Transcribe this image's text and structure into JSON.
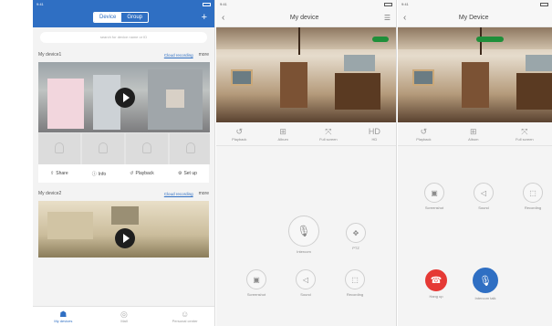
{
  "phone1": {
    "status_time": "9:41",
    "tabs_segment": [
      "Device",
      "Group"
    ],
    "add_label": "+",
    "search_placeholder": "search for device name or ID",
    "device1": {
      "title": "My device1",
      "link": "Cloud recording",
      "more": "more"
    },
    "device2": {
      "title": "My device2",
      "link": "Cloud recording",
      "more": "more"
    },
    "actions": [
      {
        "icon": "⇧",
        "label": "Share"
      },
      {
        "icon": "ⓘ",
        "label": "Info"
      },
      {
        "icon": "↺",
        "label": "Playback"
      },
      {
        "icon": "⚙",
        "label": "Set up"
      }
    ],
    "bottom_tabs": [
      {
        "icon": "☗",
        "label": "My devices"
      },
      {
        "icon": "◎",
        "label": "Mall"
      },
      {
        "icon": "☺",
        "label": "Personal center"
      }
    ]
  },
  "phone2": {
    "status_time": "9:41",
    "title": "My device",
    "toolbar": [
      {
        "icon": "↺",
        "label": "Playback"
      },
      {
        "icon": "⊞",
        "label": "Album"
      },
      {
        "icon": "⤧",
        "label": "Full screen"
      },
      {
        "icon": "HD",
        "label": "HD"
      }
    ],
    "intercom_label": "Intercom",
    "ptz_label": "PTZ",
    "controls": [
      {
        "icon": "▣",
        "label": "Screenshot"
      },
      {
        "icon": "◁",
        "label": "Sound"
      },
      {
        "icon": "⬚",
        "label": "Recording"
      }
    ]
  },
  "phone3": {
    "status_time": "9:41",
    "title": "My Device",
    "toolbar": [
      {
        "icon": "↺",
        "label": "Playback"
      },
      {
        "icon": "⊞",
        "label": "Album"
      },
      {
        "icon": "⤧",
        "label": "Full screen"
      }
    ],
    "controls": [
      {
        "icon": "▣",
        "label": "Screenshot"
      },
      {
        "icon": "◁",
        "label": "Sound"
      },
      {
        "icon": "⬚",
        "label": "Recording"
      }
    ],
    "hangup_label": "Hang up",
    "talk_label": "Intercom talk"
  }
}
